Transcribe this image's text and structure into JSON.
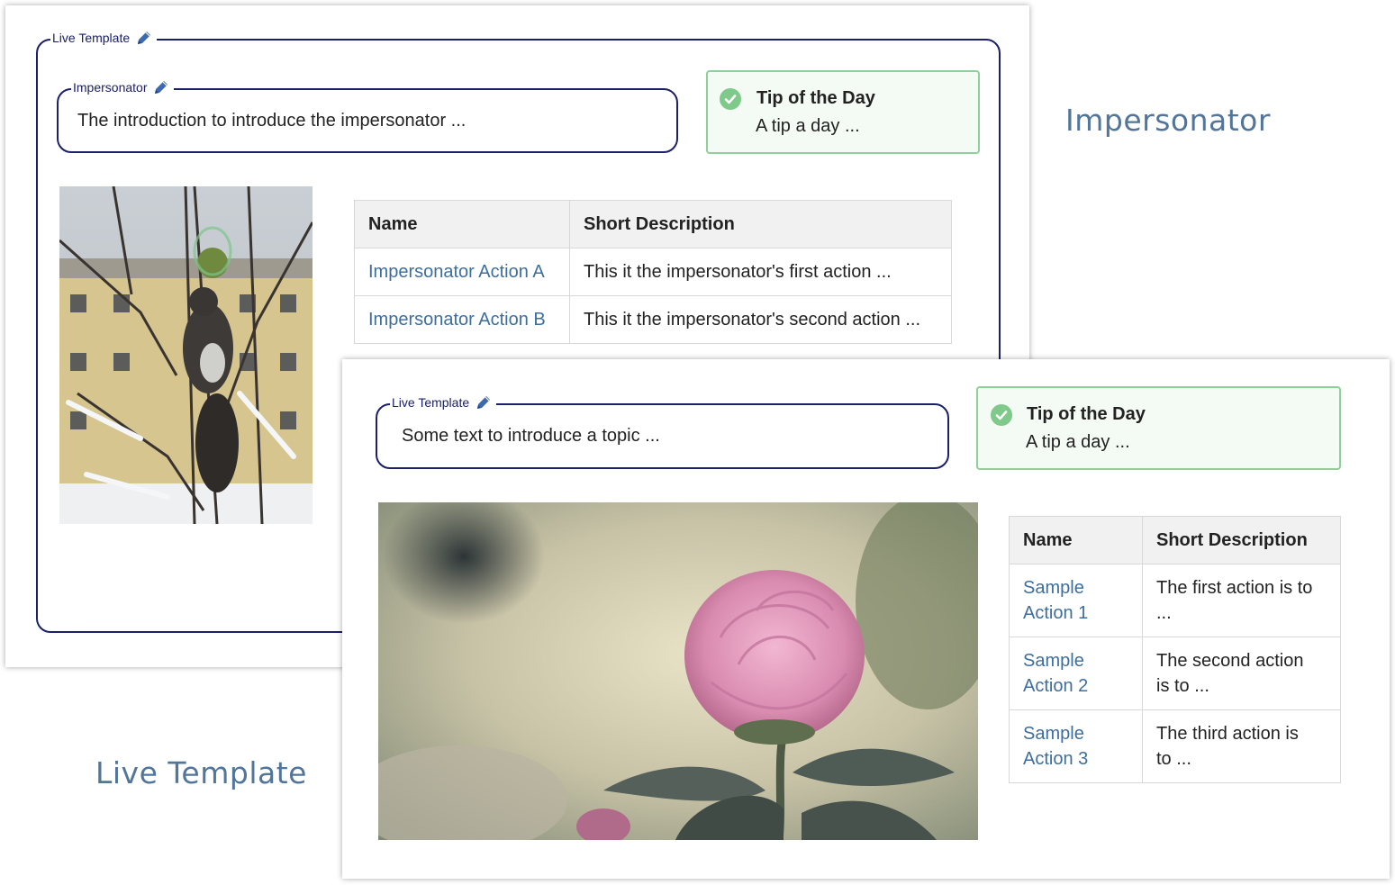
{
  "panel_impersonator": {
    "frame_label": "Live Template",
    "intro_label": "Impersonator",
    "intro_text": "The introduction to introduce the impersonator ...",
    "tip": {
      "title": "Tip of the Day",
      "text": "A tip a day ..."
    },
    "photo_icon": "squirrel-photo",
    "table": {
      "headers": [
        "Name",
        "Short Description"
      ],
      "rows": [
        {
          "name": "Impersonator Action A",
          "description": "This it the impersonator's first action ..."
        },
        {
          "name": "Impersonator Action B",
          "description": "This it the impersonator's second action ..."
        }
      ]
    }
  },
  "panel_live_template": {
    "intro_label": "Live Template",
    "intro_text": "Some text to introduce a topic ...",
    "tip": {
      "title": "Tip of the Day",
      "text": "A tip a day ..."
    },
    "photo_icon": "rose-photo",
    "table": {
      "headers": [
        "Name",
        "Short Description"
      ],
      "rows": [
        {
          "name_line1": "Sample",
          "name_line2": "Action 1",
          "desc_line1": "The first action is to",
          "desc_line2": "..."
        },
        {
          "name_line1": "Sample",
          "name_line2": "Action 2",
          "desc_line1": "The second action",
          "desc_line2": "is to ..."
        },
        {
          "name_line1": "Sample",
          "name_line2": "Action 3",
          "desc_line1": "The third action is",
          "desc_line2": "to ..."
        }
      ]
    }
  },
  "captions": {
    "impersonator": "Impersonator",
    "live_template": "Live Template"
  },
  "icons": {
    "edit": "pencil-icon",
    "tip": "check-circle-icon"
  },
  "colors": {
    "frame": "#1b2068",
    "link": "#3d6e9e",
    "tip_border": "#8fcf9a",
    "tip_background": "#f4faf4",
    "caption": "#52759a"
  }
}
